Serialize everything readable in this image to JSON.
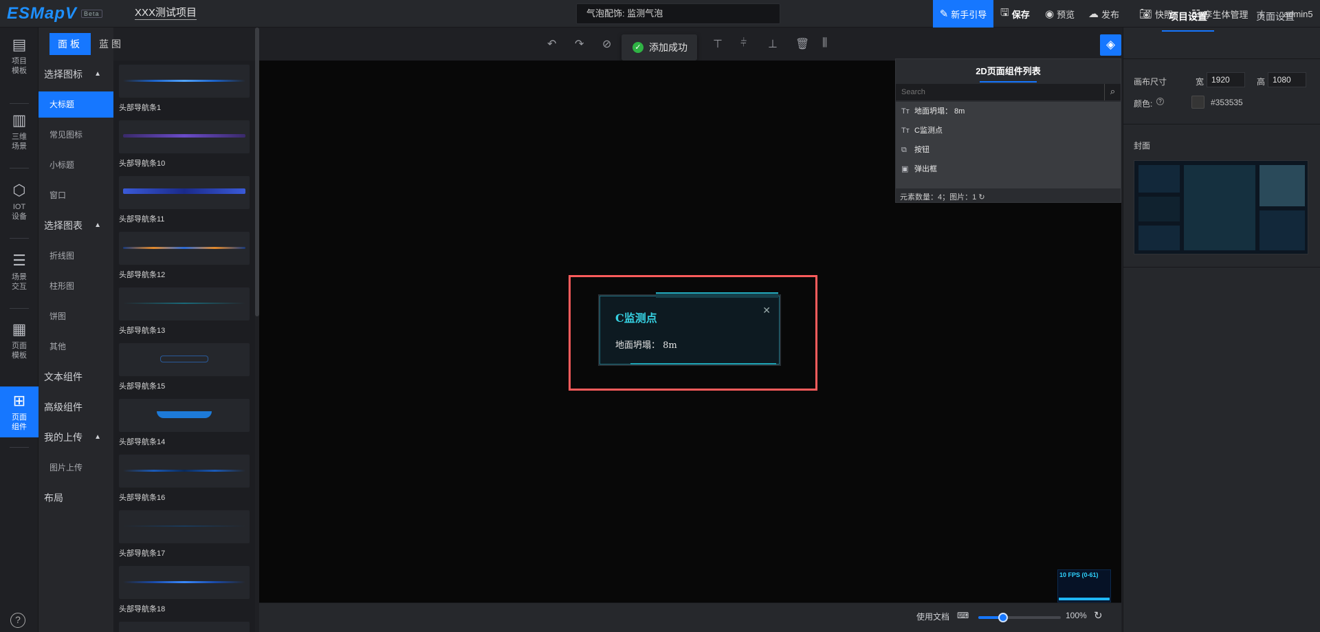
{
  "app": {
    "logo": "ESMapV",
    "beta": "Beta",
    "project_name": "XXX测试项目",
    "bubble_text": "气泡配饰: 监测气泡"
  },
  "header": {
    "guide": "新手引导",
    "save": "保存",
    "preview": "预览",
    "publish": "发布",
    "snapshot": "快照",
    "twin": "孪生体管理",
    "user": "admin5"
  },
  "leftnav": [
    {
      "label": "项目\n模板",
      "icon": "project-template-icon"
    },
    {
      "label": "三维\n场景",
      "icon": "building-icon"
    },
    {
      "label": "IOT\n设备",
      "icon": "cube-icon"
    },
    {
      "label": "场景\n交互",
      "icon": "sliders-icon"
    },
    {
      "label": "页面\n模板",
      "icon": "layout-icon"
    },
    {
      "label": "页面\n组件",
      "icon": "grid-icon"
    }
  ],
  "tabs": {
    "panel": "面板",
    "blueprint": "蓝图"
  },
  "categories": {
    "select_icon": "选择图标",
    "big_title": "大标题",
    "common_icon": "常见图标",
    "small_title": "小标题",
    "window": "窗口",
    "select_chart": "选择图表",
    "line": "折线图",
    "bar": "柱形图",
    "pie": "饼图",
    "other": "其他",
    "text_comp": "文本组件",
    "adv_comp": "高级组件",
    "my_upload": "我的上传",
    "image_upload": "图片上传",
    "layout": "布局"
  },
  "thumbs": [
    "头部导航条1",
    "头部导航条10",
    "头部导航条11",
    "头部导航条12",
    "头部导航条13",
    "头部导航条15",
    "头部导航条14",
    "头部导航条16",
    "头部导航条17",
    "头部导航条18"
  ],
  "toast": "添加成功",
  "complist": {
    "title": "2D页面组件列表",
    "search_placeholder": "Search",
    "items": [
      {
        "icon": "Tт",
        "label": "地面坍塌：  8m"
      },
      {
        "icon": "Tт",
        "label": "C监测点"
      },
      {
        "icon": "⧉",
        "label": "按钮"
      },
      {
        "icon": "▣",
        "label": "弹出框"
      }
    ],
    "count": "元素数量：4；图片：1"
  },
  "popup": {
    "title": "C监测点",
    "body": "地面坍塌：  8m"
  },
  "fps": "10 FPS (0-61)",
  "bottom": {
    "docs": "使用文档",
    "zoom": "100%",
    "zoom_fraction": 0.3
  },
  "right": {
    "tab_project": "项目设置",
    "tab_page": "页面设置",
    "canvas_size": "画布尺寸",
    "width_label": "宽",
    "width": "1920",
    "height_label": "高",
    "height": "1080",
    "color_label": "颜色:",
    "color": "#353535",
    "cover_label": "封面"
  }
}
